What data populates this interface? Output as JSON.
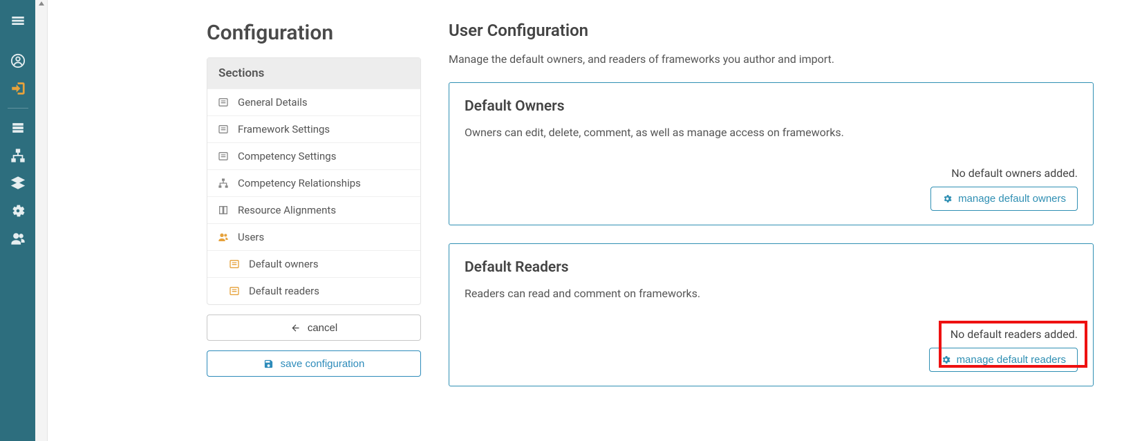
{
  "sidebar": {
    "items": [
      {
        "name": "hamburger-icon"
      },
      {
        "name": "user-circle-icon"
      },
      {
        "name": "logout-icon"
      },
      {
        "name": "list-icon"
      },
      {
        "name": "sitemap-icon"
      },
      {
        "name": "layers-icon"
      },
      {
        "name": "gear-icon"
      },
      {
        "name": "users-icon"
      }
    ]
  },
  "page": {
    "title": "Configuration",
    "sections_header": "Sections",
    "sections": [
      {
        "label": "General Details",
        "icon": "form"
      },
      {
        "label": "Framework Settings",
        "icon": "form"
      },
      {
        "label": "Competency Settings",
        "icon": "form"
      },
      {
        "label": "Competency Relationships",
        "icon": "sitemap"
      },
      {
        "label": "Resource Alignments",
        "icon": "book"
      },
      {
        "label": "Users",
        "icon": "users",
        "active": true
      }
    ],
    "sub_sections": [
      {
        "label": "Default owners"
      },
      {
        "label": "Default readers"
      }
    ],
    "cancel_label": "cancel",
    "save_label": "save configuration"
  },
  "content": {
    "title": "User Configuration",
    "subtitle": "Manage the default owners, and readers of frameworks you author and import.",
    "owners": {
      "title": "Default Owners",
      "desc": "Owners can edit, delete, comment, as well as manage access on frameworks.",
      "empty": "No default owners added.",
      "button": "manage default owners"
    },
    "readers": {
      "title": "Default Readers",
      "desc": "Readers can read and comment on frameworks.",
      "empty": "No default readers added.",
      "button": "manage default readers"
    }
  }
}
